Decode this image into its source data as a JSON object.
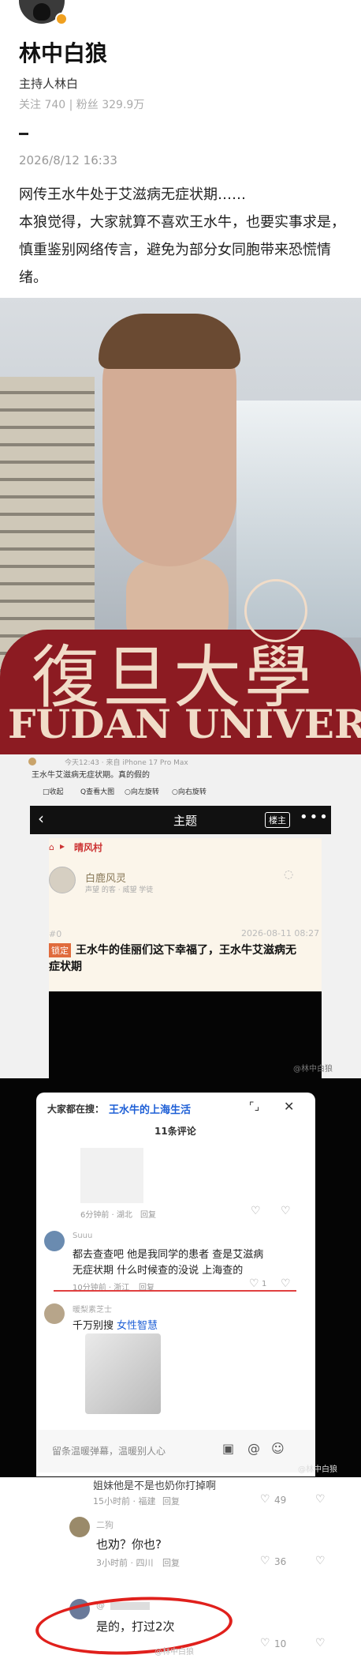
{
  "profile": {
    "name": "林中白狼",
    "title": "主持人林白",
    "stats": "关注 740 | 粉丝 329.9万",
    "date": "2026/8/12 16:33"
  },
  "post": {
    "line1": "网传王水牛处于艾滋病无症状期……",
    "line2": "本狼觉得，大家就算不喜欢王水牛，也要实事求是，",
    "line3": "慎重鉴别网络传言，避免为部分女同胞带来恐慌情",
    "line4": "绪。"
  },
  "photo": {
    "shirt_cn": "復旦大學",
    "shirt_en": "FUDAN UNIVERS"
  },
  "shot1": {
    "meta": "今天12:43 · 来自 iPhone 17 Pro Max",
    "caption": "王水牛艾滋病无症状期。真的假的",
    "actions": [
      "□收起",
      "Q查看大图",
      "○向左旋转",
      "○向右旋转"
    ],
    "back_icon": "chevron-left-icon",
    "forum_title": "主题",
    "host_badge": "楼主",
    "breadcrumb": "晴风村",
    "poster_name": "白鹿风灵",
    "poster_tags": "声望 的客 · 威望 学徒",
    "floor": "#0",
    "post_date": "2026-08-11 08:27",
    "locked_tag": "锁定",
    "post_title_1": "王水牛的佳丽们这下幸福了，王水牛艾滋病无",
    "post_title_2": "症状期",
    "watermark": "@林中白狼"
  },
  "shot2": {
    "search_prefix": "大家都在搜：",
    "search_term": "王水牛的上海生活",
    "comment_count": "11条评论",
    "c0_meta": "6分钟前 · 湖北",
    "c0_reply": "回复",
    "c1_user": "Suuu",
    "c1_line1": "都去查查吧 他是我同学的患者 查是艾滋病",
    "c1_line2": "无症状期 什么时候查的没说 上海查的",
    "c1_meta": "10分钟前 · 浙江",
    "c1_reply": "回复",
    "c1_likes": "1",
    "c2_user": "暖梨素芝士",
    "c2_text": "千万别搜",
    "c2_link": "女性智慧",
    "input_placeholder": "留条温暖弹幕，温暖别人心",
    "watermark": "@林中白狼"
  },
  "shot3": {
    "partial_top": "姐妹他是不是也奶你打掉啊",
    "c0_meta": "15小时前 · 福建",
    "c0_reply": "回复",
    "c0_likes": "49",
    "c1_user": "二狗",
    "c1_text": "也劝？你也?",
    "c1_meta": "3小时前 · 四川",
    "c1_reply": "回复",
    "c1_likes": "36",
    "c2_user": "@",
    "c2_text": "是的，打过2次",
    "c2_likes": "10",
    "watermark": "@林中白狼"
  }
}
